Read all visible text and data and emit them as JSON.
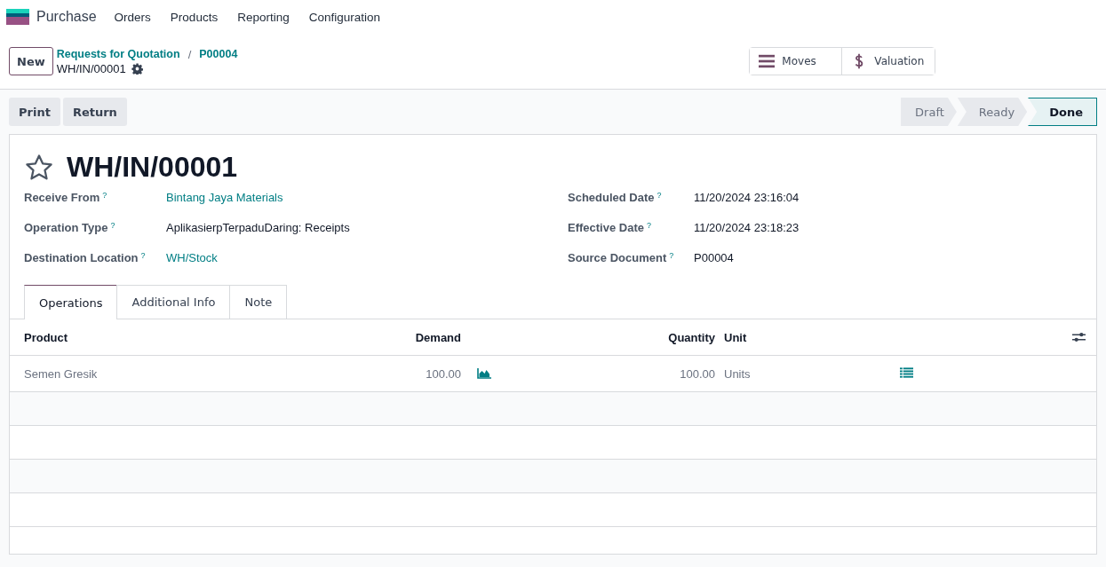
{
  "nav": {
    "app": "Purchase",
    "menu": [
      "Orders",
      "Products",
      "Reporting",
      "Configuration"
    ]
  },
  "control_panel": {
    "new_button": "New",
    "breadcrumbs": [
      "Requests for Quotation",
      "P00004"
    ],
    "separator": "/",
    "current": "WH/IN/00001",
    "smart_buttons": [
      {
        "kind": "moves",
        "label": "Moves"
      },
      {
        "kind": "valuation",
        "label": "Valuation"
      }
    ]
  },
  "actions": [
    "Print",
    "Return"
  ],
  "stages": [
    {
      "label": "Draft",
      "selected": false
    },
    {
      "label": "Ready",
      "selected": false
    },
    {
      "label": "Done",
      "selected": true
    }
  ],
  "record": {
    "title": "WH/IN/00001",
    "starred": false,
    "left_fields": [
      {
        "label": "Receive From",
        "help": "?",
        "value": "Bintang Jaya Materials",
        "kind": "link"
      },
      {
        "label": "Operation Type",
        "help": "?",
        "value": "AplikasierpTerpaduDaring: Receipts",
        "kind": "text"
      },
      {
        "label": "Destination Location",
        "help": "?",
        "value": "WH/Stock",
        "kind": "link"
      }
    ],
    "right_fields": [
      {
        "label": "Scheduled Date",
        "help": "?",
        "value": "11/20/2024 23:16:04"
      },
      {
        "label": "Effective Date",
        "help": "?",
        "value": "11/20/2024 23:18:23"
      },
      {
        "label": "Source Document",
        "help": "?",
        "value": "P00004"
      }
    ]
  },
  "tabs": [
    {
      "label": "Operations",
      "selected": true
    },
    {
      "label": "Additional Info",
      "selected": false
    },
    {
      "label": "Note",
      "selected": false
    }
  ],
  "table": {
    "columns": [
      "Product",
      "Demand",
      "Quantity",
      "Unit"
    ],
    "rows": [
      {
        "product": "Semen Gresik",
        "demand": "100.00",
        "quantity": "100.00",
        "unit": "Units"
      }
    ]
  }
}
